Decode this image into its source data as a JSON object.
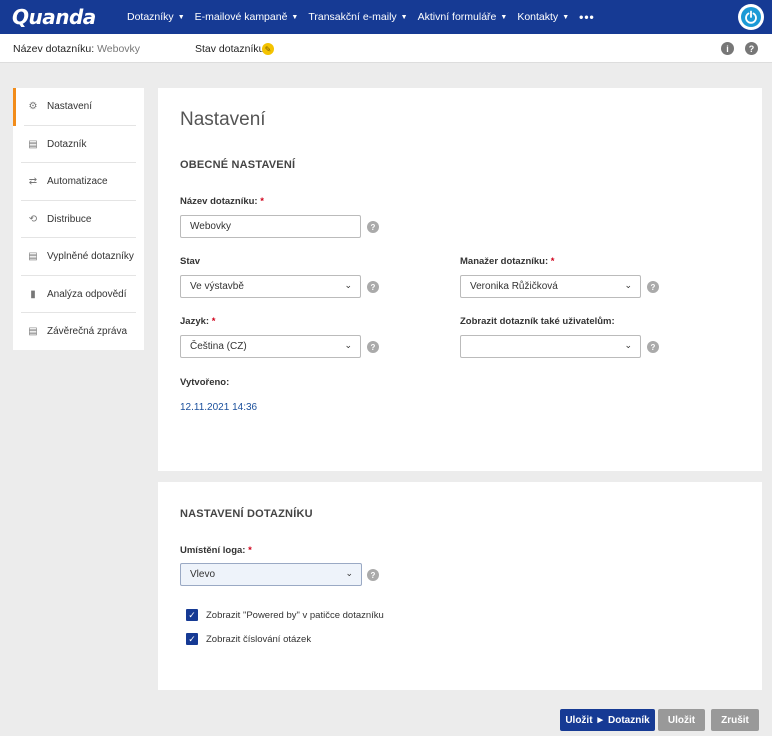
{
  "topbar": {
    "logo": "Quanda",
    "nav": [
      {
        "label": "Dotazníky",
        "caret": "▼"
      },
      {
        "label": "E-mailové kampaně",
        "caret": "▼"
      },
      {
        "label": "Transakční e-maily",
        "caret": "▼"
      },
      {
        "label": "Aktivní formuláře",
        "caret": "▼"
      },
      {
        "label": "Kontakty",
        "caret": "▼"
      }
    ],
    "more": "•••",
    "power_icon": "power-icon"
  },
  "subheader": {
    "name_label": "Název dotazníku:",
    "name_value": "Webovky",
    "status_label": "Stav dotazníku:",
    "status_icon": "✎",
    "info_icon": "i",
    "help_icon": "?"
  },
  "sidebar": {
    "items": [
      {
        "label": "Nastavení",
        "icon": "⚙"
      },
      {
        "label": "Dotazník",
        "icon": "▤"
      },
      {
        "label": "Automatizace",
        "icon": "⇄"
      },
      {
        "label": "Distribuce",
        "icon": "⟲"
      },
      {
        "label": "Vyplněné dotazníky",
        "icon": "▤"
      },
      {
        "label": "Analýza odpovědí",
        "icon": "▮"
      },
      {
        "label": "Závěrečná zpráva",
        "icon": "▤"
      }
    ]
  },
  "general": {
    "page_title": "Nastavení",
    "section_title": "OBECNÉ NASTAVENÍ",
    "name_label": "Název dotazníku:",
    "name_value": "Webovky",
    "state_label": "Stav",
    "state_value": "Ve výstavbě",
    "manager_label": "Manažer dotazníku:",
    "manager_value": "Veronika Růžičková",
    "language_label": "Jazyk:",
    "language_value": "Čeština (CZ)",
    "share_label": "Zobrazit dotazník také uživatelům:",
    "share_value": "",
    "created_label": "Vytvořeno:",
    "created_value": "12.11.2021 14:36",
    "required_mark": "*",
    "help_mark": "?",
    "chevron": "⌄"
  },
  "questionnaire": {
    "section_title": "NASTAVENÍ DOTAZNÍKU",
    "logo_label": "Umístění loga:",
    "logo_value": "Vlevo",
    "check_powered": "Zobrazit \"Powered by\" v patičce dotazníku",
    "check_numbering": "Zobrazit číslování otázek",
    "check_mark": "✓"
  },
  "buttons": {
    "save_go": "Uložit ► Dotazník",
    "save": "Uložit",
    "cancel": "Zrušit"
  }
}
